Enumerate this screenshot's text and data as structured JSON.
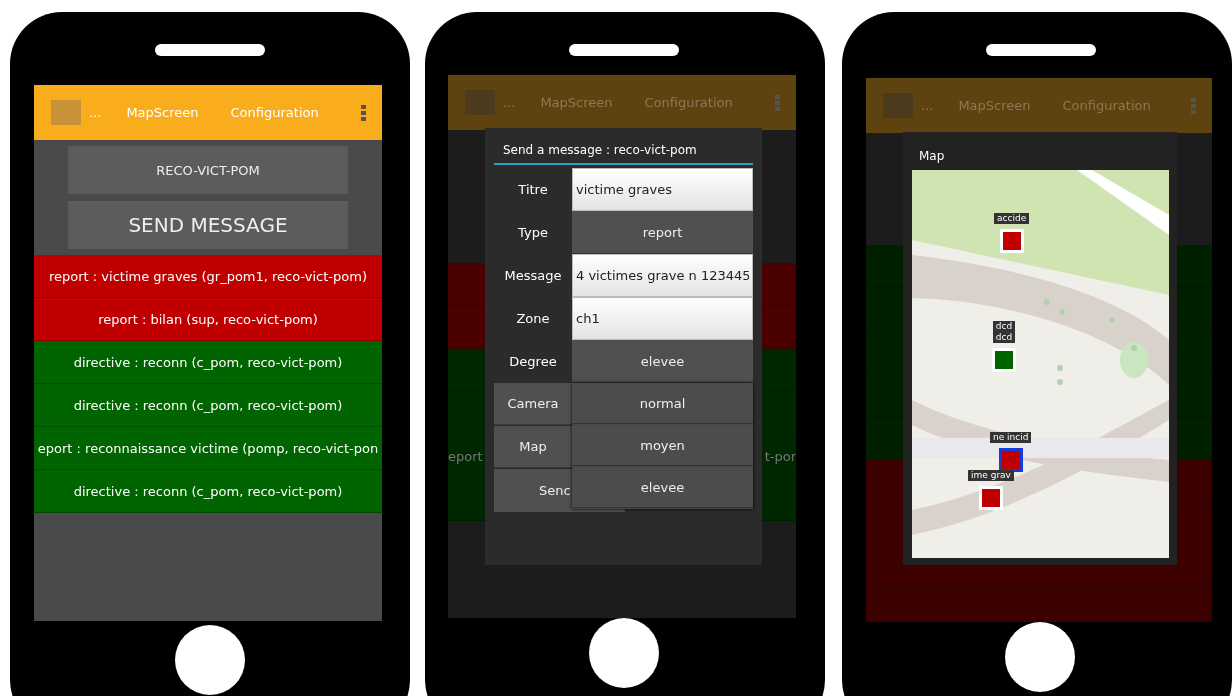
{
  "phones": [
    {
      "kind": "list",
      "dimmed": false,
      "app_bar": {
        "ellipsis": "...",
        "tabs": [
          "MapScreen",
          "Configuration"
        ]
      },
      "channel_button": "RECO-VICT-POM",
      "send_button": "SEND MESSAGE",
      "messages": [
        {
          "text": "report : victime graves (gr_pom1, reco-vict-pom)",
          "color": "#c00000"
        },
        {
          "text": "report : bilan (sup, reco-vict-pom)",
          "color": "#c00000"
        },
        {
          "text": "directive : reconn (c_pom, reco-vict-pom)",
          "color": "#006400"
        },
        {
          "text": "directive : reconn (c_pom, reco-vict-pom)",
          "color": "#006400"
        },
        {
          "text": "eport : reconnaissance victime  (pomp, reco-vict-pon",
          "color": "#006400"
        },
        {
          "text": "directive : reconn (c_pom, reco-vict-pom)",
          "color": "#006400"
        }
      ]
    },
    {
      "kind": "form",
      "dimmed": true,
      "app_bar": {
        "ellipsis": "...",
        "tabs": [
          "MapScreen",
          "Configuration"
        ]
      },
      "background_rows": [
        {
          "color": "#4a0000"
        },
        {
          "color": "#4a0000"
        },
        {
          "color": "#002800"
        },
        {
          "color": "#002800"
        },
        {
          "color": "#002800",
          "left": "eport",
          "right": "t-por"
        },
        {
          "color": "#002800"
        }
      ],
      "dialog": {
        "title": "Send a message : reco-vict-pom",
        "rows": [
          {
            "label": "Titre",
            "kind": "input",
            "value": "victime graves"
          },
          {
            "label": "Type",
            "kind": "select",
            "value": "report"
          },
          {
            "label": "Message",
            "kind": "input",
            "value": "4 victimes grave n 123445"
          },
          {
            "label": "Zone",
            "kind": "input",
            "value": "ch1"
          },
          {
            "label": "Degree",
            "kind": "select",
            "value": "elevee"
          }
        ],
        "buttons": [
          "Camera",
          "Map"
        ],
        "send_button": "Senc",
        "dropdown_options": [
          "normal",
          "moyen",
          "elevee"
        ]
      }
    },
    {
      "kind": "map",
      "dimmed": true,
      "app_bar": {
        "ellipsis": "...",
        "tabs": [
          "MapScreen",
          "Configuration"
        ]
      },
      "background_rows": [
        {
          "color": "#002000"
        },
        {
          "color": "#002000"
        },
        {
          "color": "#002000"
        },
        {
          "color": "#002000"
        },
        {
          "color": "#002000"
        },
        {
          "color": "#3c0000"
        },
        {
          "color": "#3c0000"
        },
        {
          "color": "#3c0000"
        },
        {
          "color": "#3c0000"
        }
      ],
      "dialog": {
        "title": "Map",
        "markers": [
          {
            "labels": [
              "accide"
            ],
            "kind": "pin",
            "color": "#c00000"
          },
          {
            "labels": [
              "dcd",
              "dcd"
            ],
            "kind": "pin",
            "color": "#006400"
          },
          {
            "labels": [
              "ne incid"
            ],
            "kind": "framed",
            "color": "#c00000"
          },
          {
            "labels": [
              "ime grav"
            ],
            "kind": "pin",
            "color": "#c00000"
          }
        ]
      }
    }
  ]
}
